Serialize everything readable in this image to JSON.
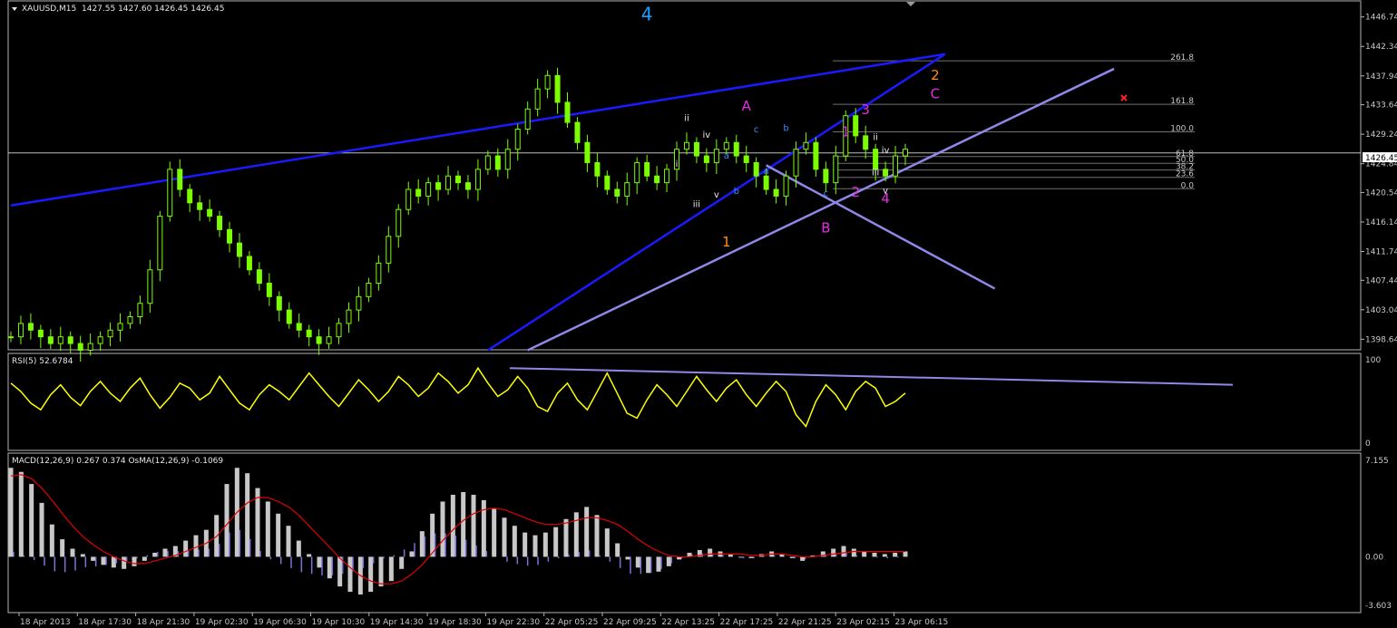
{
  "header": {
    "symbol": "XAUUSD,M15",
    "ohlc": "1427.55 1427.60 1426.45 1426.45"
  },
  "colors": {
    "background": "#000000",
    "candle": "#7CFC00",
    "trend_blue": "#1a1aff",
    "trend_lavender": "#8f88e8",
    "rsi_line": "#ffff00",
    "macd_hist": "#c8c8c8",
    "macd_signal": "#e00000",
    "osma": "#7a74d8",
    "wave_cyan": "#1e9fff",
    "wave_magenta": "#e030e0",
    "wave_orange": "#ff8c1a"
  },
  "chart_data": [
    {
      "type": "line",
      "panel": "price",
      "ylim": [
        1397.2,
        1449.0
      ],
      "yticks": [
        "1446.74",
        "1442.34",
        "1437.94",
        "1433.64",
        "1429.24",
        "1424.84",
        "1420.54",
        "1416.14",
        "1411.74",
        "1407.44",
        "1403.04",
        "1398.64"
      ],
      "yvalues": [
        1446.74,
        1442.34,
        1437.94,
        1433.64,
        1429.24,
        1424.84,
        1420.54,
        1416.14,
        1411.74,
        1407.44,
        1403.04,
        1398.64
      ],
      "current_price": "1426.45",
      "current_value": 1426.45,
      "close_series": [
        1399,
        1401,
        1400,
        1399,
        1398,
        1399,
        1398,
        1397,
        1398,
        1399,
        1400,
        1401,
        1402,
        1404,
        1409,
        1417,
        1424,
        1421,
        1419,
        1418,
        1417,
        1415,
        1413,
        1411,
        1409,
        1407,
        1405,
        1403,
        1401,
        1400,
        1399,
        1398,
        1399,
        1401,
        1403,
        1405,
        1407,
        1410,
        1414,
        1418,
        1421,
        1420,
        1422,
        1421,
        1423,
        1422,
        1421,
        1424,
        1426,
        1424,
        1427,
        1430,
        1433,
        1436,
        1438,
        1434,
        1431,
        1428,
        1425,
        1423,
        1421,
        1420,
        1422,
        1425,
        1423,
        1422,
        1424,
        1427,
        1428,
        1426,
        1425,
        1427,
        1428,
        1426,
        1425,
        1423,
        1421,
        1420,
        1423,
        1427,
        1428,
        1424,
        1422,
        1426,
        1432,
        1429,
        1427,
        1424,
        1423,
        1426,
        1427
      ],
      "fib_levels": [
        {
          "label": "261.8",
          "value": 1440.2
        },
        {
          "label": "161.8",
          "value": 1433.7
        },
        {
          "label": "100.0",
          "value": 1429.6
        },
        {
          "label": "61.8",
          "value": 1425.9
        },
        {
          "label": "50.0",
          "value": 1424.9
        },
        {
          "label": "38.2",
          "value": 1423.9
        },
        {
          "label": "23.6",
          "value": 1422.8
        },
        {
          "label": "0.0",
          "value": 1421.1
        }
      ],
      "wave_labels": [
        {
          "text": "4",
          "color": "cyan"
        },
        {
          "text": "A",
          "color": "magenta"
        },
        {
          "text": "B",
          "color": "magenta"
        },
        {
          "text": "C",
          "color": "magenta"
        },
        {
          "text": "1",
          "color": "orange"
        },
        {
          "text": "2",
          "color": "orange"
        },
        {
          "text": "i",
          "color": "white"
        },
        {
          "text": "ii",
          "color": "white"
        },
        {
          "text": "iii",
          "color": "white"
        },
        {
          "text": "iv",
          "color": "white"
        },
        {
          "text": "v",
          "color": "white"
        },
        {
          "text": "a",
          "color": "blue"
        },
        {
          "text": "b",
          "color": "blue"
        },
        {
          "text": "c",
          "color": "blue"
        },
        {
          "text": "a",
          "color": "blue"
        },
        {
          "text": "b",
          "color": "blue"
        },
        {
          "text": "c",
          "color": "blue"
        },
        {
          "text": "1",
          "color": "magenta"
        },
        {
          "text": "2",
          "color": "magenta"
        },
        {
          "text": "3",
          "color": "magenta"
        },
        {
          "text": "4",
          "color": "magenta"
        },
        {
          "text": "ii",
          "color": "white"
        },
        {
          "text": "iii",
          "color": "white"
        },
        {
          "text": "iv",
          "color": "white"
        },
        {
          "text": "v",
          "color": "white"
        }
      ]
    },
    {
      "type": "line",
      "panel": "rsi",
      "title": "RSI(5) 52.6784",
      "ylim": [
        0,
        100
      ],
      "yticks": [
        "100",
        "0"
      ],
      "yvalues": [
        100,
        0
      ],
      "values": [
        72,
        62,
        48,
        40,
        58,
        70,
        55,
        45,
        62,
        74,
        60,
        50,
        66,
        78,
        58,
        42,
        55,
        72,
        66,
        52,
        60,
        80,
        64,
        48,
        40,
        58,
        70,
        62,
        52,
        68,
        84,
        70,
        56,
        44,
        60,
        76,
        64,
        50,
        62,
        80,
        70,
        56,
        66,
        84,
        74,
        60,
        70,
        90,
        72,
        56,
        64,
        80,
        66,
        44,
        38,
        60,
        72,
        52,
        40,
        62,
        84,
        60,
        36,
        30,
        52,
        70,
        58,
        44,
        62,
        80,
        64,
        50,
        66,
        76,
        58,
        44,
        60,
        74,
        62,
        34,
        20,
        50,
        70,
        58,
        40,
        62,
        74,
        66,
        44,
        50,
        60
      ]
    },
    {
      "type": "bar",
      "panel": "macd",
      "title": "MACD(12,26,9) 0.267 0.374 OsMA(12,26,9) -0.1069",
      "ylim": [
        -3.603,
        7.155
      ],
      "yticks": [
        "7.155",
        "0.00",
        "-3.603"
      ],
      "yvalues": [
        7.155,
        0,
        -3.603
      ],
      "values": [
        6.6,
        6.3,
        5.4,
        4.0,
        2.4,
        1.3,
        0.6,
        0.2,
        -0.3,
        -0.6,
        -0.8,
        -0.9,
        -0.7,
        -0.3,
        0.3,
        0.6,
        0.8,
        1.2,
        1.6,
        2.0,
        3.1,
        5.4,
        6.6,
        6.2,
        5.1,
        4.1,
        3.2,
        2.3,
        1.2,
        0.2,
        -0.8,
        -1.6,
        -2.2,
        -2.6,
        -2.8,
        -2.6,
        -2.2,
        -1.8,
        -0.9,
        0.4,
        1.9,
        3.2,
        4.1,
        4.6,
        4.8,
        4.6,
        4.2,
        3.6,
        2.9,
        2.3,
        1.8,
        1.6,
        1.8,
        2.2,
        2.8,
        3.3,
        3.7,
        3.1,
        2.1,
        1.0,
        -0.2,
        -0.8,
        -1.2,
        -1.1,
        -0.7,
        -0.2,
        0.3,
        0.5,
        0.6,
        0.4,
        0.2,
        0.0,
        -0.1,
        0.2,
        0.4,
        0.2,
        -0.1,
        -0.3,
        0.1,
        0.4,
        0.6,
        0.8,
        0.6,
        0.4,
        0.3,
        0.2,
        0.3,
        0.4
      ],
      "signal": [
        6.0,
        6.1,
        5.8,
        5.1,
        4.2,
        3.2,
        2.3,
        1.5,
        0.9,
        0.4,
        0.0,
        -0.3,
        -0.5,
        -0.5,
        -0.3,
        -0.1,
        0.1,
        0.4,
        0.7,
        1.0,
        1.5,
        2.4,
        3.3,
        4.0,
        4.4,
        4.4,
        4.1,
        3.7,
        3.1,
        2.3,
        1.5,
        0.7,
        -0.1,
        -0.8,
        -1.4,
        -1.8,
        -2.0,
        -2.0,
        -1.8,
        -1.3,
        -0.6,
        0.3,
        1.2,
        2.0,
        2.7,
        3.2,
        3.5,
        3.6,
        3.5,
        3.2,
        2.9,
        2.6,
        2.4,
        2.4,
        2.5,
        2.7,
        2.9,
        2.9,
        2.7,
        2.4,
        1.9,
        1.3,
        0.8,
        0.4,
        0.1,
        0.0,
        0.0,
        0.1,
        0.2,
        0.2,
        0.2,
        0.2,
        0.1,
        0.1,
        0.2,
        0.2,
        0.1,
        0.0,
        0.0,
        0.1,
        0.2,
        0.3,
        0.4,
        0.4,
        0.4,
        0.4,
        0.4,
        0.4
      ]
    }
  ],
  "x_axis": {
    "tick_labels": [
      "18 Apr 2013",
      "18 Apr 17:30",
      "18 Apr 21:30",
      "19 Apr 02:30",
      "19 Apr 06:30",
      "19 Apr 10:30",
      "19 Apr 14:30",
      "19 Apr 18:30",
      "19 Apr 22:30",
      "22 Apr 05:25",
      "22 Apr 09:25",
      "22 Apr 13:25",
      "22 Apr 17:25",
      "22 Apr 21:25",
      "23 Apr 02:15",
      "23 Apr 06:15"
    ]
  }
}
